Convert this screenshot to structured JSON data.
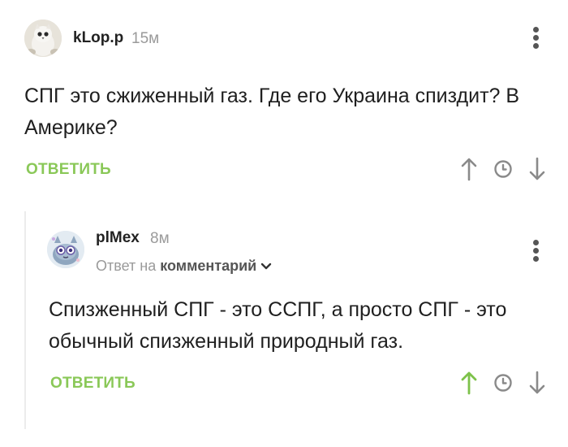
{
  "comments": [
    {
      "username": "kLop.p",
      "time": "15м",
      "text": "СПГ это сжиженный газ. Где его Украина спиздит? В Америке?",
      "reply_label": "ОТВЕТИТЬ"
    },
    {
      "username": "plMex",
      "time": "8м",
      "reply_to_prefix": "Ответ на",
      "reply_to_target": "комментарий",
      "text": "Спизженный СПГ - это ССПГ, а просто СПГ - это обычный спизженный природный газ.",
      "reply_label": "ОТВЕТИТЬ",
      "upvoted": true
    }
  ],
  "colors": {
    "accent_green": "#8ac858",
    "icon_gray": "#8a8a8a",
    "meta_gray": "#9a9a9a"
  },
  "icons": [
    "upvote-arrow-icon",
    "clock-icon",
    "downvote-arrow-icon",
    "more-vertical-icon",
    "chevron-down-icon"
  ]
}
